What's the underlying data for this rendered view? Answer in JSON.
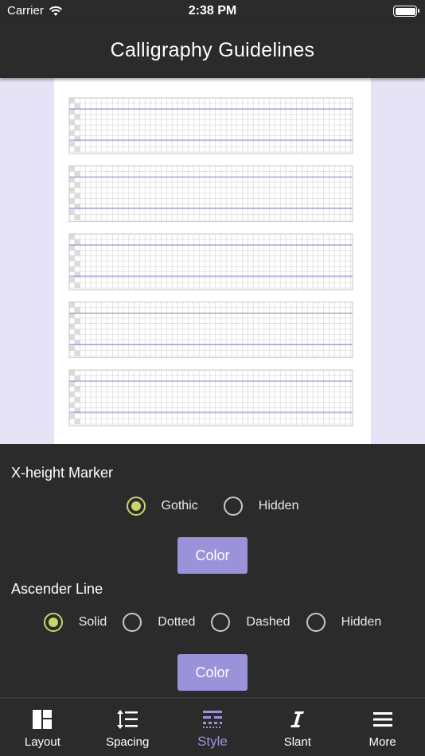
{
  "status_bar": {
    "carrier": "Carrier",
    "time": "2:38 PM"
  },
  "header": {
    "title": "Calligraphy Guidelines"
  },
  "preview": {
    "blocks": 5
  },
  "settings": {
    "xheight": {
      "title": "X-height Marker",
      "options": [
        "Gothic",
        "Hidden"
      ],
      "selected": "Gothic",
      "color_label": "Color"
    },
    "ascender": {
      "title": "Ascender Line",
      "options": [
        "Solid",
        "Dotted",
        "Dashed",
        "Hidden"
      ],
      "selected": "Solid",
      "color_label": "Color"
    }
  },
  "tabs": [
    {
      "label": "Layout",
      "icon": "layout-icon"
    },
    {
      "label": "Spacing",
      "icon": "line-spacing-icon"
    },
    {
      "label": "Style",
      "icon": "line-style-icon",
      "active": true
    },
    {
      "label": "Slant",
      "icon": "italic-icon"
    },
    {
      "label": "More",
      "icon": "menu-icon"
    }
  ],
  "colors": {
    "accent": "#9b93d9",
    "radio_selected": "#c9d46b",
    "background": "#2b2b2b",
    "preview_bg": "#e5e3f5",
    "guide_line": "#8a85cf"
  }
}
